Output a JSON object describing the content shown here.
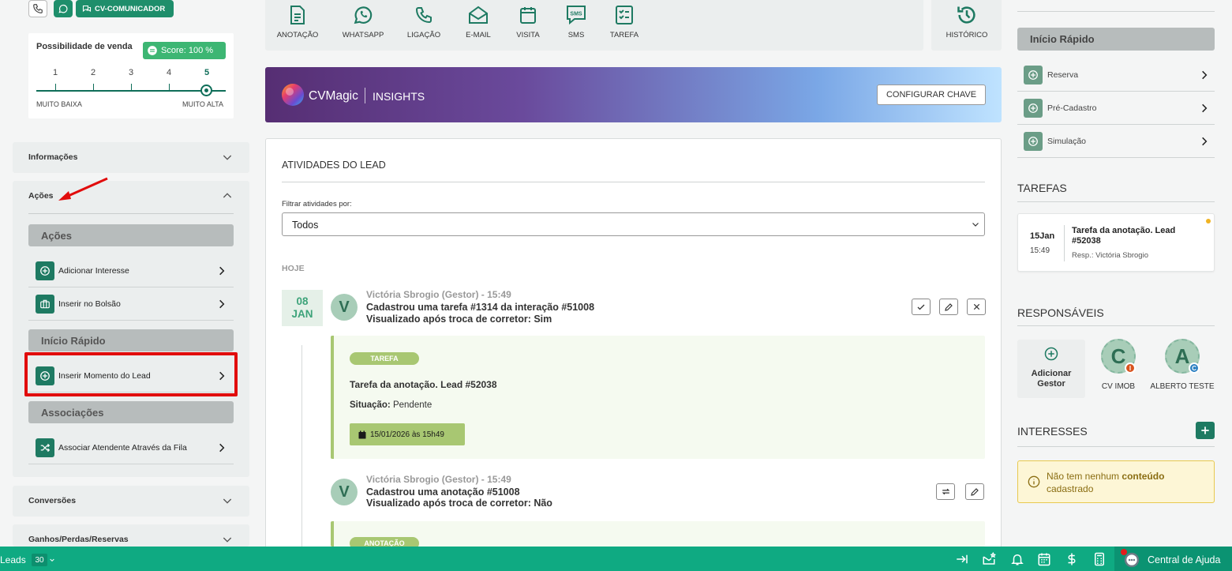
{
  "left": {
    "top_buttons": {
      "communicator_label": "CV-COMUNICADOR"
    },
    "sale_possibility": {
      "title": "Possibilidade de venda",
      "score_label": "Score: 100 %",
      "scale": [
        "1",
        "2",
        "3",
        "4",
        "5"
      ],
      "selected": "5",
      "min_label": "MUITO BAIXA",
      "max_label": "MUITO ALTA"
    },
    "sections": {
      "informacoes": "Informações",
      "acoes": "Ações",
      "conversoes": "Conversões",
      "ganhos": "Ganhos/Perdas/Reservas"
    },
    "acoes_group": {
      "acoes_header": "Ações",
      "items": [
        {
          "label": "Adicionar Interesse",
          "icon": "plus-circle-icon"
        },
        {
          "label": "Inserir no Bolsão",
          "icon": "briefcase-icon"
        }
      ],
      "inicio_header": "Início Rápido",
      "momento": {
        "label": "Inserir Momento do Lead",
        "icon": "plus-circle-icon"
      },
      "assoc_header": "Associações",
      "assoc_item": {
        "label": "Associar Atendente Através da Fila",
        "icon": "shuffle-icon"
      }
    }
  },
  "action_bar": {
    "buttons": [
      {
        "label": "ANOTAÇÃO",
        "icon": "note-icon"
      },
      {
        "label": "WHATSAPP",
        "icon": "whatsapp-icon"
      },
      {
        "label": "LIGAÇÃO",
        "icon": "phone-icon"
      },
      {
        "label": "E-MAIL",
        "icon": "mail-icon"
      },
      {
        "label": "VISITA",
        "icon": "calendar-icon"
      },
      {
        "label": "SMS",
        "icon": "sms-icon"
      },
      {
        "label": "TAREFA",
        "icon": "checklist-icon"
      }
    ],
    "history_label": "HISTÓRICO"
  },
  "banner": {
    "brand": "CVMagic",
    "section": "INSIGHTS",
    "configure_label": "CONFIGURAR CHAVE"
  },
  "activities": {
    "title": "ATIVIDADES DO LEAD",
    "filter_label": "Filtrar atividades por:",
    "filter_value": "Todos",
    "today_label": "HOJE",
    "date_day": "08",
    "date_month": "JAN",
    "events": [
      {
        "avatar": "V",
        "author": "Victória Sbrogio (Gestor) - 15:49",
        "line1": "Cadastrou uma tarefa #1314 da interação #51008",
        "line2": "Visualizado após troca de corretor:  Sim",
        "card_tag": "TAREFA",
        "card_title": "Tarefa da anotação. Lead #52038",
        "status_label": "Situação:",
        "status_value": "Pendente",
        "due_date": "15/01/2026 às 15h49"
      },
      {
        "avatar": "V",
        "author": "Victória Sbrogio (Gestor) - 15:49",
        "line1": "Cadastrou uma anotação #51008",
        "line2": "Visualizado após troca de corretor:  Não",
        "card_tag": "ANOTAÇÃO"
      }
    ]
  },
  "right": {
    "inicio_rapido": {
      "header": "Início Rápido",
      "items": [
        {
          "label": "Reserva",
          "icon": "plus-circle-icon"
        },
        {
          "label": "Pré-Cadastro",
          "icon": "plus-circle-icon"
        },
        {
          "label": "Simulação",
          "icon": "plus-circle-icon"
        }
      ]
    },
    "tarefas": {
      "header": "TAREFAS",
      "task": {
        "date": "15Jan",
        "time": "15:49",
        "title": "Tarefa da anotação. Lead #52038",
        "resp": "Resp.: Victória Sbrogio"
      }
    },
    "responsaveis": {
      "header": "RESPONSÁVEIS",
      "add_label": "Adicionar Gestor",
      "people": [
        {
          "initial": "C",
          "name": "CV IMOB",
          "badge": "I",
          "badge_color": "#d9531e"
        },
        {
          "initial": "A",
          "name": "ALBERTO TESTE",
          "badge": "C",
          "badge_color": "#2a7fc1"
        }
      ]
    },
    "interesses": {
      "header": "INTERESSES",
      "empty_prefix": "Não tem nenhum",
      "empty_bold": "conteúdo",
      "empty_suffix": "cadastrado"
    }
  },
  "bottom_bar": {
    "leads_label": "Leads",
    "leads_count": "30",
    "help_label": "Central de Ajuda"
  },
  "colors": {
    "primary": "#1e8e6b",
    "bottom_bar": "#0faa82",
    "highlight": "#e10c0c"
  }
}
